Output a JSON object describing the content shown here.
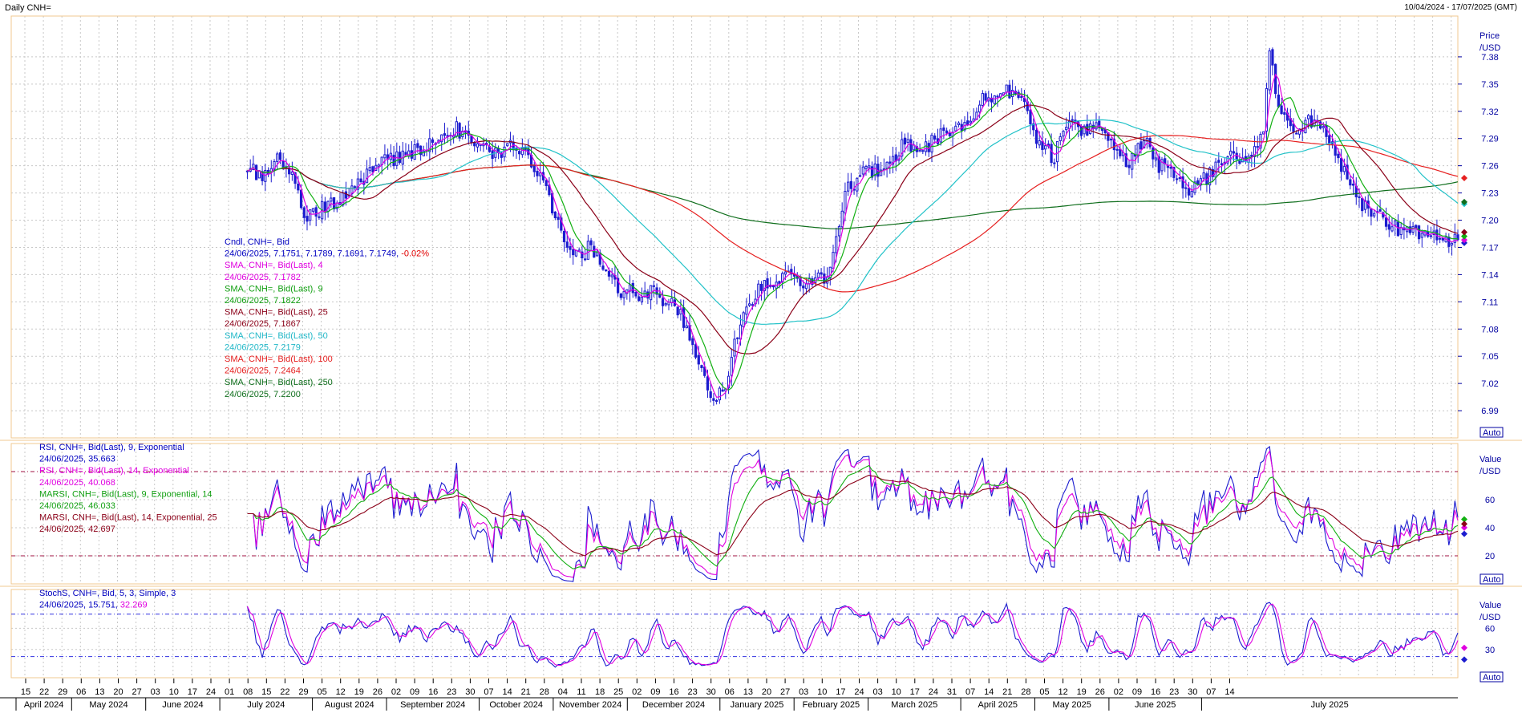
{
  "header": {
    "title": "Daily CNH=",
    "date_range": "10/04/2024 - 17/07/2025 (GMT)"
  },
  "colors": {
    "candles": "#1c1ccf",
    "sma4": "#e000e0",
    "sma9": "#12b012",
    "sma25": "#8b0018",
    "sma50": "#22c2c8",
    "sma100": "#e62020",
    "sma250": "#0f6e1c",
    "grid": "#c8c8c8",
    "panel_border": "#f0c890",
    "axis_text": "#0000a0"
  },
  "chart_data": [
    {
      "type": "candlestick",
      "panel": "price",
      "axis_title": [
        "Price",
        "/USD"
      ],
      "auto_label": "Auto",
      "ylim": [
        6.96,
        7.425
      ],
      "yticks": [
        6.99,
        7.02,
        7.05,
        7.08,
        7.11,
        7.14,
        7.17,
        7.2,
        7.23,
        7.26,
        7.29,
        7.32,
        7.35,
        7.38
      ],
      "series": [
        {
          "name": "Cndl, CNH=, Bid",
          "key": "close",
          "anchors": [
            [
              0,
              7.255
            ],
            [
              5,
              7.25
            ],
            [
              10,
              7.265
            ],
            [
              15,
              7.245
            ],
            [
              20,
              7.2
            ],
            [
              25,
              7.215
            ],
            [
              30,
              7.22
            ],
            [
              35,
              7.235
            ],
            [
              40,
              7.25
            ],
            [
              45,
              7.265
            ],
            [
              50,
              7.27
            ],
            [
              55,
              7.275
            ],
            [
              60,
              7.28
            ],
            [
              65,
              7.295
            ],
            [
              70,
              7.3
            ],
            [
              75,
              7.285
            ],
            [
              80,
              7.28
            ],
            [
              85,
              7.27
            ],
            [
              90,
              7.285
            ],
            [
              95,
              7.26
            ],
            [
              100,
              7.24
            ],
            [
              105,
              7.18
            ],
            [
              110,
              7.16
            ],
            [
              115,
              7.17
            ],
            [
              120,
              7.15
            ],
            [
              125,
              7.12
            ],
            [
              130,
              7.12
            ],
            [
              135,
              7.12
            ],
            [
              140,
              7.11
            ],
            [
              145,
              7.1
            ],
            [
              150,
              7.05
            ],
            [
              155,
              7.0
            ],
            [
              160,
              7.02
            ],
            [
              165,
              7.09
            ],
            [
              170,
              7.12
            ],
            [
              175,
              7.13
            ],
            [
              180,
              7.14
            ],
            [
              185,
              7.13
            ],
            [
              190,
              7.135
            ],
            [
              195,
              7.14
            ],
            [
              200,
              7.23
            ],
            [
              205,
              7.25
            ],
            [
              210,
              7.255
            ],
            [
              215,
              7.26
            ],
            [
              220,
              7.29
            ],
            [
              225,
              7.275
            ],
            [
              230,
              7.29
            ],
            [
              235,
              7.3
            ],
            [
              240,
              7.305
            ],
            [
              245,
              7.33
            ],
            [
              250,
              7.34
            ],
            [
              255,
              7.34
            ],
            [
              260,
              7.33
            ],
            [
              265,
              7.28
            ],
            [
              270,
              7.27
            ],
            [
              275,
              7.31
            ],
            [
              280,
              7.3
            ],
            [
              285,
              7.3
            ],
            [
              290,
              7.28
            ],
            [
              295,
              7.26
            ],
            [
              300,
              7.29
            ],
            [
              305,
              7.26
            ],
            [
              310,
              7.25
            ],
            [
              315,
              7.23
            ],
            [
              320,
              7.245
            ],
            [
              325,
              7.26
            ],
            [
              330,
              7.27
            ],
            [
              335,
              7.27
            ],
            [
              340,
              7.3
            ],
            [
              342,
              7.39
            ],
            [
              345,
              7.32
            ],
            [
              350,
              7.3
            ],
            [
              355,
              7.31
            ],
            [
              360,
              7.3
            ],
            [
              365,
              7.27
            ],
            [
              370,
              7.23
            ],
            [
              375,
              7.21
            ],
            [
              380,
              7.2
            ],
            [
              385,
              7.19
            ],
            [
              390,
              7.185
            ],
            [
              395,
              7.18
            ],
            [
              400,
              7.18
            ],
            [
              405,
              7.175
            ]
          ]
        },
        {
          "name": "SMA, CNH=, Bid(Last), 4",
          "key": "sma4",
          "period": 4
        },
        {
          "name": "SMA, CNH=, Bid(Last), 9",
          "key": "sma9",
          "period": 9
        },
        {
          "name": "SMA, CNH=, Bid(Last), 25",
          "key": "sma25",
          "period": 25
        },
        {
          "name": "SMA, CNH=, Bid(Last), 50",
          "key": "sma50",
          "period": 50
        },
        {
          "name": "SMA, CNH=, Bid(Last), 100",
          "key": "sma100",
          "period": 100
        },
        {
          "name": "SMA, CNH=, Bid(Last), 250",
          "key": "sma250",
          "period": 250
        }
      ],
      "legend": [
        {
          "text": "Cndl, CNH=, Bid",
          "color": "#0000c0"
        },
        {
          "text": "24/06/2025, 7.1751, 7.1789, 7.1691, 7.1749,",
          "color": "#0000c0",
          "suffix": "-0.02%",
          "suffix_color": "#e00000"
        },
        {
          "text": "SMA, CNH=, Bid(Last),  4",
          "color": "#e000e0"
        },
        {
          "text": "24/06/2025, 7.1782",
          "color": "#e000e0"
        },
        {
          "text": "SMA, CNH=, Bid(Last),  9",
          "color": "#12a012"
        },
        {
          "text": "24/06/2025, 7.1822",
          "color": "#12a012"
        },
        {
          "text": "SMA, CNH=, Bid(Last),  25",
          "color": "#8b0018"
        },
        {
          "text": "24/06/2025, 7.1867",
          "color": "#8b0018"
        },
        {
          "text": "SMA, CNH=, Bid(Last),  50",
          "color": "#22b8c8"
        },
        {
          "text": "24/06/2025, 7.2179",
          "color": "#22b8c8"
        },
        {
          "text": "SMA, CNH=, Bid(Last),  100",
          "color": "#e62020"
        },
        {
          "text": "24/06/2025, 7.2464",
          "color": "#e62020"
        },
        {
          "text": "SMA, CNH=, Bid(Last),  250",
          "color": "#0f6e1c"
        },
        {
          "text": "24/06/2025, 7.2200",
          "color": "#0f6e1c"
        }
      ],
      "last_values": {
        "close": 7.1749,
        "sma4": 7.1782,
        "sma9": 7.1822,
        "sma25": 7.1867,
        "sma50": 7.2179,
        "sma100": 7.2464,
        "sma250": 7.22
      }
    },
    {
      "type": "line",
      "panel": "rsi",
      "axis_title": [
        "Value",
        "/USD"
      ],
      "auto_label": "Auto",
      "ylim": [
        0,
        100
      ],
      "yticks": [
        20,
        40,
        60
      ],
      "reference_lines": [
        20,
        80
      ],
      "series": [
        {
          "name": "RSI, CNH=, Bid(Last), 9, Exponential",
          "key": "rsi9",
          "period": 9
        },
        {
          "name": "RSI, CNH=, Bid(Last), 14, Exponential",
          "key": "rsi14",
          "period": 14
        },
        {
          "name": "MARSI, CNH=, Bid(Last), 9, Exponential, 14",
          "key": "marsi9",
          "period": 9
        },
        {
          "name": "MARSI, CNH=, Bid(Last), 14, Exponential, 25",
          "key": "marsi14",
          "period": 14
        }
      ],
      "legend": [
        {
          "text": "RSI, CNH=, Bid(Last),  9, Exponential",
          "color": "#0000c0"
        },
        {
          "text": "24/06/2025, 35.663",
          "color": "#0000c0"
        },
        {
          "text": "RSI, CNH=, Bid(Last),  14, Exponential",
          "color": "#e000e0"
        },
        {
          "text": "24/06/2025, 40.068",
          "color": "#e000e0"
        },
        {
          "text": "MARSI, CNH=, Bid(Last),  9, Exponential, 14",
          "color": "#12a012"
        },
        {
          "text": "24/06/2025, 46.033",
          "color": "#12a012"
        },
        {
          "text": "MARSI, CNH=, Bid(Last),  14, Exponential, 25",
          "color": "#8b0018"
        },
        {
          "text": "24/06/2025, 42.697",
          "color": "#8b0018"
        }
      ],
      "last_values": {
        "rsi9": 35.663,
        "rsi14": 40.068,
        "marsi9": 46.033,
        "marsi14": 42.697
      }
    },
    {
      "type": "line",
      "panel": "stoch",
      "axis_title": [
        "Value",
        "/USD"
      ],
      "auto_label": "Auto",
      "ylim": [
        -10,
        115
      ],
      "yticks": [
        30,
        60
      ],
      "reference_lines": [
        20,
        80
      ],
      "series": [
        {
          "name": "StochS, CNH=, Bid, 5, 3, Simple, 3",
          "key": "k"
        },
        {
          "name": "StochS %D",
          "key": "d"
        }
      ],
      "legend": [
        {
          "text": "StochS, CNH=, Bid,  5, 3, Simple, 3",
          "color": "#0000c0"
        },
        {
          "text": "24/06/2025, 15.751,",
          "color": "#0000c0",
          "suffix": "32.269",
          "suffix_color": "#e000e0"
        }
      ],
      "last_values": {
        "k": 15.751,
        "d": 32.269
      }
    }
  ],
  "x_axis": {
    "day_ticks": [
      "15",
      "22",
      "29",
      "06",
      "13",
      "20",
      "27",
      "03",
      "10",
      "17",
      "24",
      "01",
      "08",
      "15",
      "22",
      "29",
      "05",
      "12",
      "19",
      "26",
      "02",
      "09",
      "16",
      "23",
      "30",
      "07",
      "14",
      "21",
      "28",
      "04",
      "11",
      "18",
      "25",
      "02",
      "09",
      "16",
      "23",
      "30",
      "06",
      "13",
      "20",
      "27",
      "03",
      "10",
      "17",
      "24",
      "03",
      "10",
      "17",
      "24",
      "31",
      "07",
      "14",
      "21",
      "28",
      "05",
      "12",
      "19",
      "26",
      "02",
      "09",
      "16",
      "23",
      "30",
      "07",
      "14"
    ],
    "month_labels": [
      "April 2024",
      "May 2024",
      "June 2024",
      "July 2024",
      "August 2024",
      "September 2024",
      "October 2024",
      "November 2024",
      "December 2024",
      "January 2025",
      "February 2025",
      "March 2025",
      "April 2025",
      "May 2025",
      "June 2025",
      "July 2025"
    ]
  }
}
